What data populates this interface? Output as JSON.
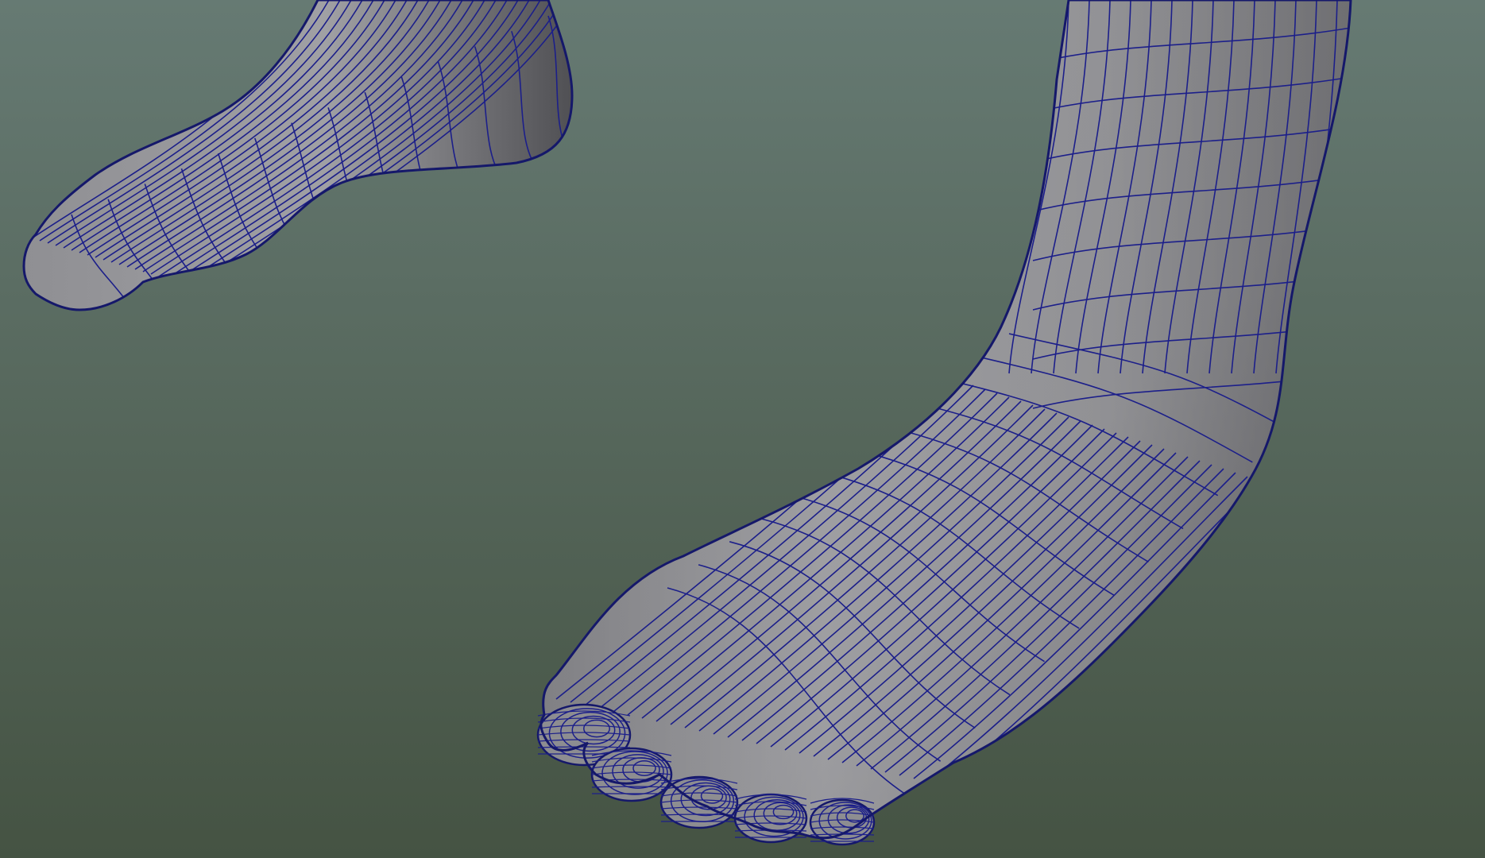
{
  "viewport": {
    "background_top": "#667a73",
    "background_bottom": "#455343",
    "mesh_fill_light": "#a3a3a6",
    "mesh_fill_dark": "#565659",
    "wireframe_color": "#1c1f8a"
  }
}
